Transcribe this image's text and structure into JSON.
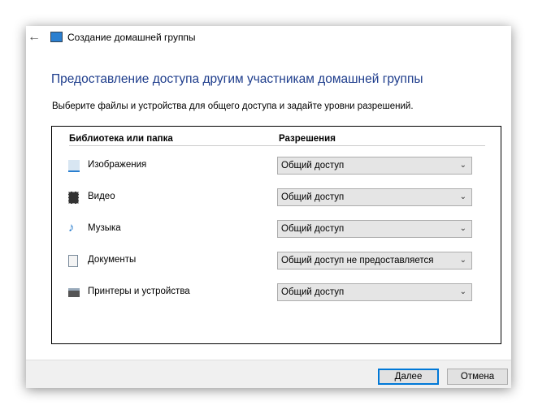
{
  "window": {
    "title": "Создание домашней группы"
  },
  "heading": "Предоставление доступа другим участникам домашней группы",
  "description": "Выберите файлы и устройства для общего доступа и задайте уровни разрешений.",
  "table": {
    "col_library": "Библиотека или папка",
    "col_permissions": "Разрешения",
    "rows": [
      {
        "label": "Изображения",
        "permission": "Общий доступ",
        "icon": "pictures-icon"
      },
      {
        "label": "Видео",
        "permission": "Общий доступ",
        "icon": "video-icon"
      },
      {
        "label": "Музыка",
        "permission": "Общий доступ",
        "icon": "music-icon"
      },
      {
        "label": "Документы",
        "permission": "Общий доступ не предоставляется",
        "icon": "documents-icon"
      },
      {
        "label": "Принтеры и устройства",
        "permission": "Общий доступ",
        "icon": "printer-icon"
      }
    ]
  },
  "buttons": {
    "next": "Далее",
    "cancel": "Отмена"
  },
  "colors": {
    "heading": "#1e3d8c",
    "accent": "#0078d7"
  }
}
